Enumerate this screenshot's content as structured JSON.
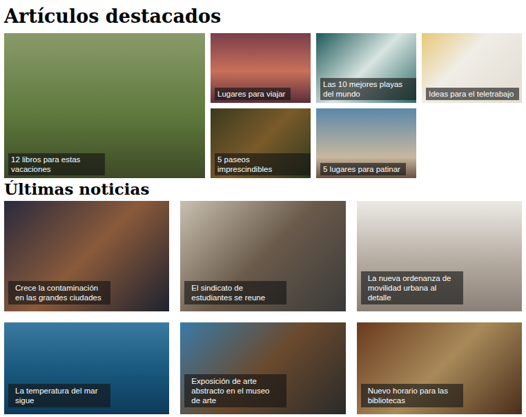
{
  "featured": {
    "title": "Artículos destacados",
    "articles": [
      {
        "caption": "12 libros para estas vacaciones",
        "kind": "large"
      },
      {
        "caption": "Lugares para viajar",
        "kind": "small"
      },
      {
        "caption": "Las 10 mejores playas del mundo",
        "kind": "small"
      },
      {
        "caption": "Ideas para el teletrabajo",
        "kind": "small"
      },
      {
        "caption": "5 paseos imprescindibles",
        "kind": "small"
      },
      {
        "caption": "5 lugares para patinar",
        "kind": "small"
      }
    ]
  },
  "latest": {
    "title": "Últimas noticias",
    "articles": [
      {
        "caption": "Crece la contaminación en las grandes ciudades"
      },
      {
        "caption": "El sindicato de estudiantes se reune"
      },
      {
        "caption": "La nueva ordenanza de movilidad urbana al detalle"
      },
      {
        "caption": "La temperatura del mar sigue"
      },
      {
        "caption": "Exposición de arte abstracto en el museo de arte"
      },
      {
        "caption": "Nuevo horario para las bibliotecas"
      }
    ]
  }
}
